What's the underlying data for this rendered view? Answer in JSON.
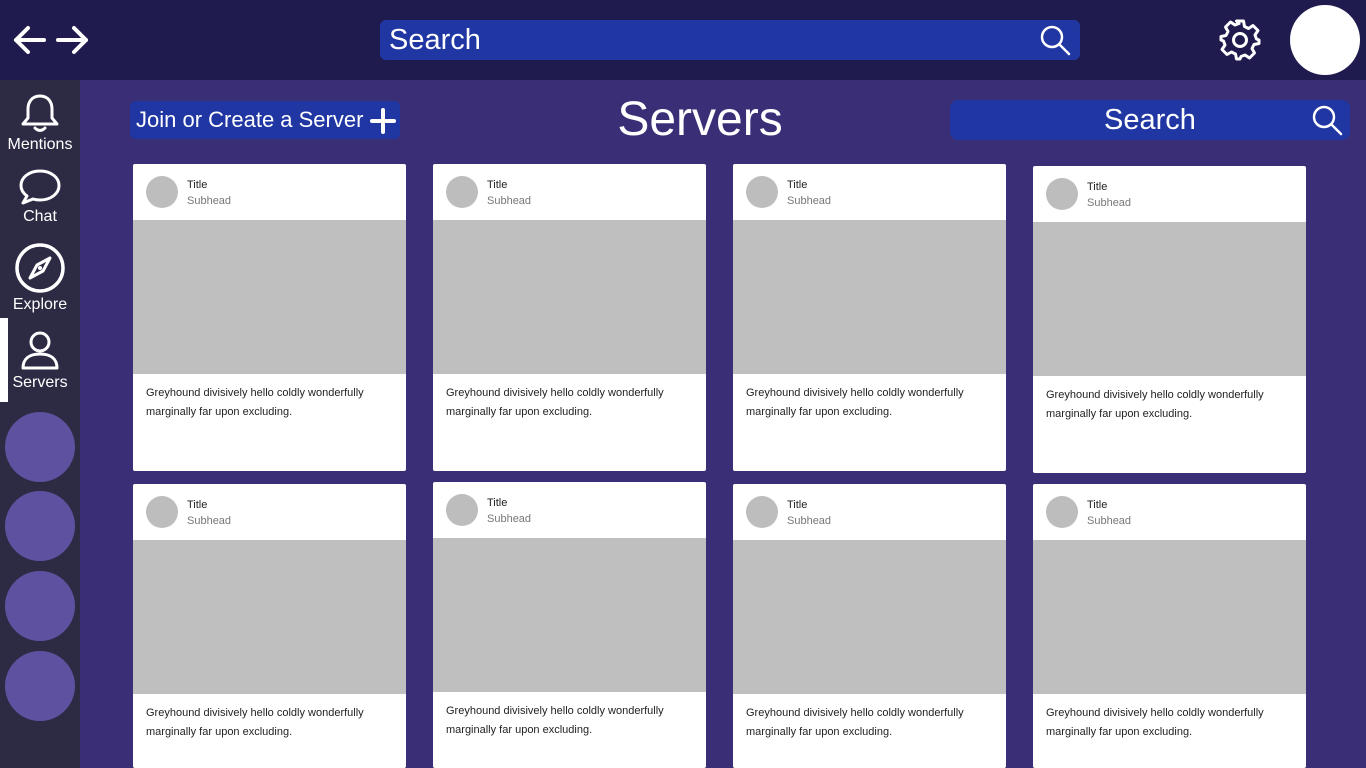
{
  "topbar": {
    "search_placeholder": "Search"
  },
  "sidebar": {
    "items": [
      {
        "label": "Mentions"
      },
      {
        "label": "Chat"
      },
      {
        "label": "Explore"
      },
      {
        "label": "Servers"
      }
    ]
  },
  "header": {
    "join_label": "Join or Create a Server",
    "title": "Servers",
    "search_placeholder": "Search"
  },
  "cards": [
    {
      "title": "Title",
      "subhead": "Subhead",
      "description": "Greyhound divisively hello coldly wonderfully marginally far upon excluding."
    },
    {
      "title": "Title",
      "subhead": "Subhead",
      "description": "Greyhound divisively hello coldly wonderfully marginally far upon excluding."
    },
    {
      "title": "Title",
      "subhead": "Subhead",
      "description": "Greyhound divisively hello coldly wonderfully marginally far upon excluding."
    },
    {
      "title": "Title",
      "subhead": "Subhead",
      "description": "Greyhound divisively hello coldly wonderfully marginally far upon excluding."
    },
    {
      "title": "Title",
      "subhead": "Subhead",
      "description": "Greyhound divisively hello coldly wonderfully marginally far upon excluding."
    },
    {
      "title": "Title",
      "subhead": "Subhead",
      "description": "Greyhound divisively hello coldly wonderfully marginally far upon excluding."
    },
    {
      "title": "Title",
      "subhead": "Subhead",
      "description": "Greyhound divisively hello coldly wonderfully marginally far upon excluding."
    },
    {
      "title": "Title",
      "subhead": "Subhead",
      "description": "Greyhound divisively hello coldly wonderfully marginally far upon excluding."
    }
  ],
  "colors": {
    "topbar_bg": "#1f1b4e",
    "page_bg": "#3a2f77",
    "sidebar_bg": "#2d2a44",
    "accent_blue": "#1f36a3",
    "server_circle": "#5e52a0"
  }
}
